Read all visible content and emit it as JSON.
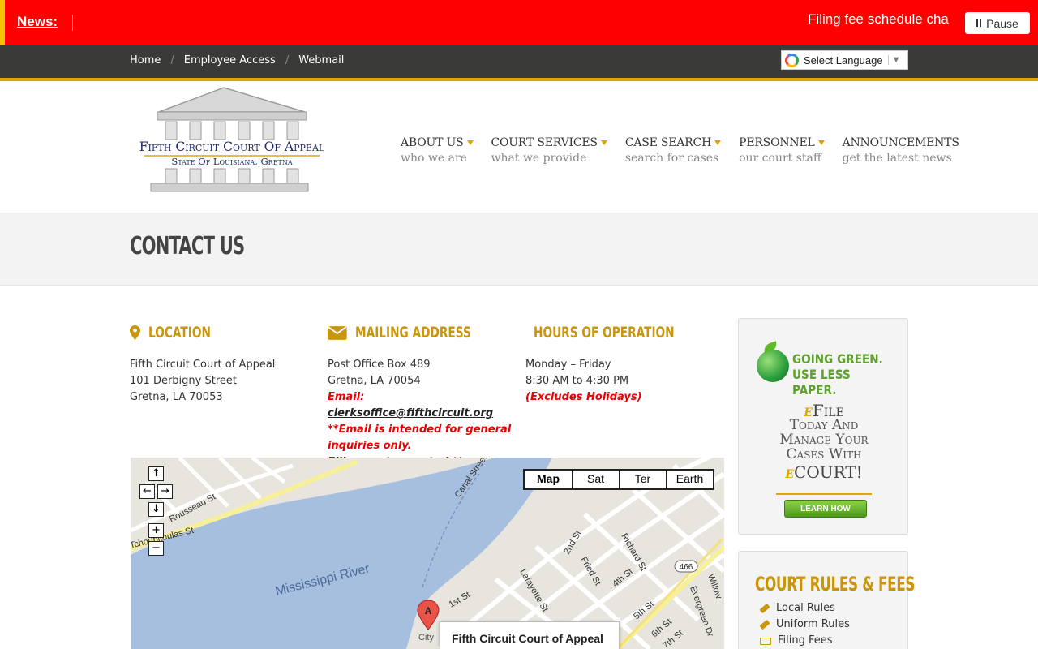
{
  "news": {
    "label": "News:",
    "ticker": "Filing fee schedule cha",
    "pause_label": "Pause"
  },
  "util_nav": {
    "items": [
      "Home",
      "Employee Access",
      "Webmail"
    ],
    "separator": "/"
  },
  "language": {
    "label": "Select Language",
    "arrow": "▼"
  },
  "logo": {
    "line1": "Fifth Circuit Court Of Appeal",
    "line2": "State Of Louisiana, Gretna"
  },
  "main_nav": [
    {
      "title": "ABOUT US",
      "sub": "who we are",
      "has_dropdown": true
    },
    {
      "title": "COURT SERVICES",
      "sub": "what we provide",
      "has_dropdown": true
    },
    {
      "title": "CASE SEARCH",
      "sub": "search for cases",
      "has_dropdown": true
    },
    {
      "title": "PERSONNEL",
      "sub": "our court staff",
      "has_dropdown": true
    },
    {
      "title": "ANNOUNCEMENTS",
      "sub": "get the latest news",
      "has_dropdown": false
    }
  ],
  "page": {
    "title": "CONTACT US"
  },
  "location": {
    "heading": "LOCATION",
    "lines": [
      "Fifth Circuit Court of Appeal",
      "101 Derbigny Street",
      "Gretna, LA 70053"
    ]
  },
  "mailing": {
    "heading": "MAILING ADDRESS",
    "lines": [
      "Post Office Box 489",
      "Gretna, LA 70054"
    ],
    "email_prefix": "Email: ",
    "email": "clerksoffice@fifthcircuit.org",
    "note1": "**Email is intended for general inquiries only.",
    "note2": "Filings not accepted.**"
  },
  "hours": {
    "heading": "HOURS OF OPERATION",
    "lines": [
      "Monday – Friday",
      "8:30 AM to 4:30 PM"
    ],
    "note": "(Excludes Holidays)"
  },
  "map": {
    "types": [
      "Map",
      "Sat",
      "Ter",
      "Earth"
    ],
    "river_label": "Mississippi River",
    "infowindow": "Fifth Circuit Court of Appeal",
    "marker": "A",
    "streets": [
      "Canal Street",
      "Rousseau St",
      "Tchoupitoulas St",
      "1st St",
      "2nd St",
      "Fried St",
      "Lafayette St",
      "Richard St",
      "4th St",
      "5th St",
      "6th St",
      "7th St",
      "Evergreen Dr",
      "Willow"
    ],
    "route_shield": "466",
    "city_label": "City"
  },
  "efile": {
    "green_line1": "GOING GREEN.",
    "green_line2": "USE LESS PAPER.",
    "l1_e": "e",
    "l1_rest": "File",
    "l2": "Today And",
    "l3": "Manage Your",
    "l4": "Cases With",
    "l5_e": "e",
    "l5_rest": "COURT!",
    "button": "LEARN HOW"
  },
  "rules": {
    "title": "COURT RULES & FEES",
    "items": [
      {
        "label": "Local Rules",
        "icon": "gavel-icon"
      },
      {
        "label": "Uniform Rules",
        "icon": "gavel-icon"
      },
      {
        "label": "Filing Fees",
        "icon": "money-icon"
      }
    ]
  },
  "colors": {
    "news_red": "#ff0000",
    "accent_gold": "#e0a500",
    "heading_gold": "#c9950a",
    "util_bar": "#3a3a38"
  }
}
